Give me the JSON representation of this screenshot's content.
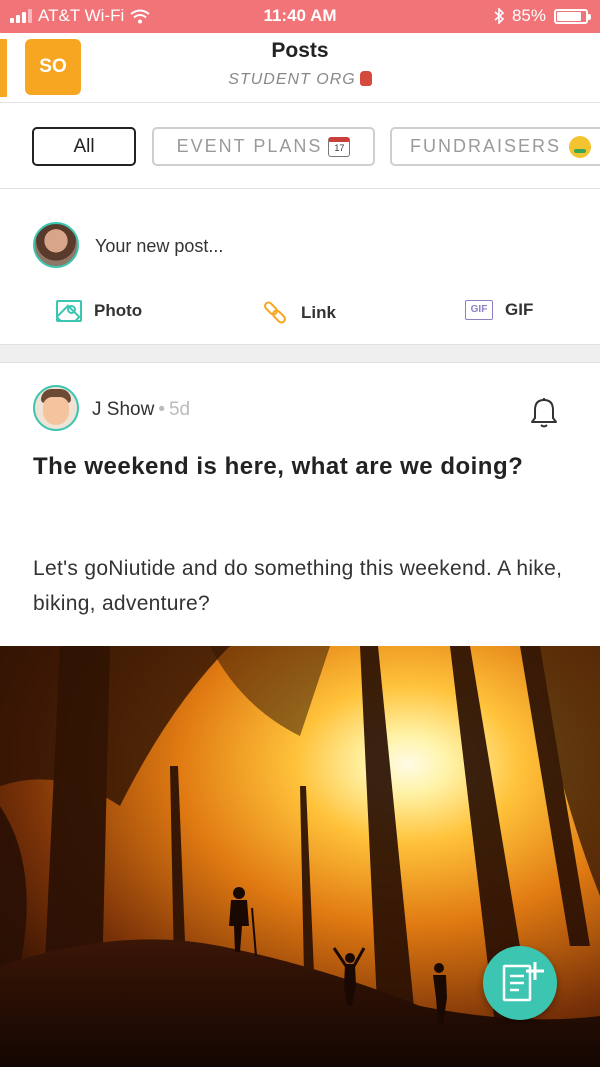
{
  "status_bar": {
    "carrier": "AT&T Wi-Fi",
    "time": "11:40 AM",
    "battery": "85%",
    "battery_level": 0.85
  },
  "header": {
    "org_initials": "SO",
    "title": "Posts",
    "subtitle": "STUDENT ORG",
    "accent_color": "#f6a620"
  },
  "filters": [
    {
      "label": "All",
      "active": true
    },
    {
      "label": "EVENT PLANS",
      "icon": "calendar-emoji"
    },
    {
      "label": "FUNDRAISERS",
      "icon": "money-mouth-emoji"
    }
  ],
  "composer": {
    "placeholder": "Your new post...",
    "actions": {
      "photo": "Photo",
      "link": "Link",
      "gif": "GIF",
      "gif_icon_text": "GIF"
    }
  },
  "post": {
    "author": "J Show",
    "separator": "•",
    "age": "5d",
    "title": "The weekend is here, what are we doing?",
    "body": "Let's goNiutide and do something this weekend. A hike, biking, adventure?"
  },
  "colors": {
    "status_bar": "#f07478",
    "teal": "#3cc6b2",
    "orange": "#f6a620"
  },
  "calendar_day": "17"
}
